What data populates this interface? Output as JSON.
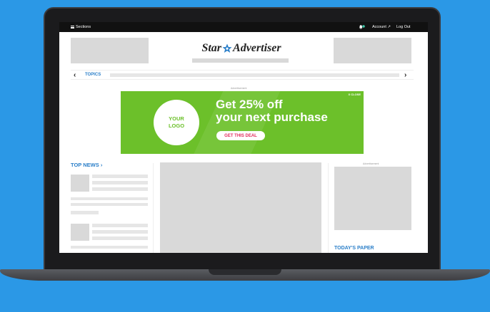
{
  "topbar": {
    "sections_label": "Sections",
    "account_label": "Account",
    "logout_label": "Log Out"
  },
  "header": {
    "logo_left": "Star",
    "logo_right": "Advertiser"
  },
  "topics": {
    "label": "TOPICS"
  },
  "ad": {
    "label": "Advertisement",
    "close_label": "X CLOSE",
    "logo_text": "YOUR LOGO",
    "headline_line1": "Get 25% off",
    "headline_line2": "your next purchase",
    "cta_label": "GET THIS DEAL",
    "green": "#6cc02a",
    "cta_color": "#e22a5c"
  },
  "sidebar_ad": {
    "label": "Advertisement"
  },
  "sections": {
    "top_news": "TOP NEWS",
    "todays_paper": "TODAY'S PAPER"
  },
  "colors": {
    "accent_blue": "#2b7fc9",
    "background": "#2b98e6"
  }
}
